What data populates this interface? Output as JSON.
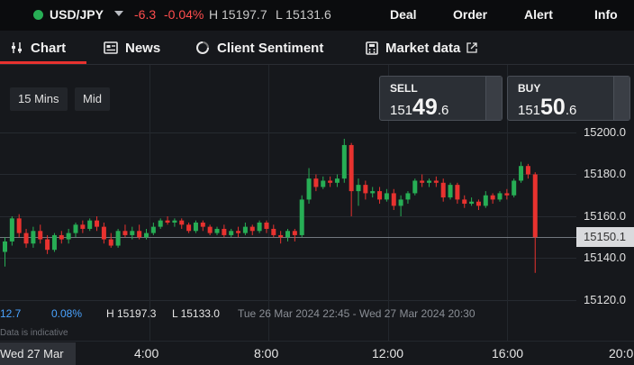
{
  "topbar": {
    "symbol": "USD/JPY",
    "change": "-6.3",
    "change_pct": "-0.04%",
    "high": "H 15197.7",
    "low": "L 15131.6",
    "nav": [
      "Deal",
      "Order",
      "Alert",
      "Info"
    ]
  },
  "tabs": {
    "chart": "Chart",
    "news": "News",
    "sentiment": "Client Sentiment",
    "market": "Market data"
  },
  "timeframe": {
    "interval": "15 Mins",
    "price_type": "Mid"
  },
  "trade": {
    "sell": {
      "label": "SELL",
      "small": "151",
      "big": "49",
      "tail": ".6"
    },
    "buy": {
      "label": "BUY",
      "small": "151",
      "big": "50",
      "tail": ".6"
    }
  },
  "yaxis": {
    "ticks": [
      "15200.0",
      "15180.0",
      "15160.0",
      "15140.0",
      "15120.0"
    ],
    "current": "15150.1"
  },
  "stats": {
    "left_value": "12.7",
    "pct": "0.08%",
    "high": "H 15197.3",
    "low": "L 15133.0",
    "range": "Tue 26 Mar 2024 22:45 - Wed 27 Mar 2024 20:30",
    "indicative": "Data is indicative"
  },
  "xaxis": {
    "current_date": "Wed 27 Mar",
    "ticks": [
      "4:00",
      "8:00",
      "12:00",
      "16:00",
      "20:0"
    ]
  },
  "colors": {
    "up": "#27ae55",
    "down": "#e8322f",
    "accent": "#e8322f"
  },
  "chart_data": {
    "type": "candlestick",
    "yticks": [
      15200,
      15180,
      15160,
      15140,
      15120
    ],
    "current_price": 15150.1,
    "candles": [
      [
        15143,
        15148,
        15136,
        15150
      ],
      [
        15148,
        15159,
        15146,
        15160
      ],
      [
        15159,
        15152,
        15150,
        15161
      ],
      [
        15152,
        15147,
        15145,
        15154
      ],
      [
        15147,
        15153,
        15145,
        15155
      ],
      [
        15153,
        15149,
        15147,
        15156
      ],
      [
        15149,
        15144,
        15142,
        15151
      ],
      [
        15144,
        15151,
        15143,
        15152
      ],
      [
        15151,
        15149,
        15147,
        15153
      ],
      [
        15149,
        15152,
        15147,
        15154
      ],
      [
        15152,
        15156,
        15150,
        15157
      ],
      [
        15156,
        15154,
        15152,
        15158
      ],
      [
        15154,
        15158,
        15153,
        15159
      ],
      [
        15158,
        15155,
        15153,
        15160
      ],
      [
        15155,
        15149,
        15147,
        15157
      ],
      [
        15149,
        15146,
        15145,
        15152
      ],
      [
        15146,
        15153,
        15145,
        15154
      ],
      [
        15153,
        15151,
        15150,
        15156
      ],
      [
        15151,
        15153,
        15149,
        15155
      ],
      [
        15153,
        15150,
        15149,
        15156
      ],
      [
        15150,
        15152,
        15149,
        15154
      ],
      [
        15152,
        15155,
        15151,
        15157
      ],
      [
        15155,
        15158,
        15154,
        15159
      ],
      [
        15158,
        15157,
        15156,
        15160
      ],
      [
        15157,
        15158,
        15155,
        15159
      ],
      [
        15158,
        15156,
        15154,
        15159
      ],
      [
        15156,
        15153,
        15152,
        15157
      ],
      [
        15153,
        15157,
        15152,
        15158
      ],
      [
        15157,
        15155,
        15153,
        15158
      ],
      [
        15155,
        15152,
        15151,
        15156
      ],
      [
        15152,
        15154,
        15151,
        15155
      ],
      [
        15154,
        15151,
        15150,
        15156
      ],
      [
        15151,
        15153,
        15150,
        15154
      ],
      [
        15153,
        15152,
        15150,
        15155
      ],
      [
        15152,
        15155,
        15151,
        15157
      ],
      [
        15155,
        15153,
        15151,
        15156
      ],
      [
        15153,
        15157,
        15152,
        15158
      ],
      [
        15157,
        15154,
        15152,
        15158
      ],
      [
        15154,
        15151,
        15150,
        15156
      ],
      [
        15151,
        15150,
        15147,
        15153
      ],
      [
        15150,
        15153,
        15148,
        15154
      ],
      [
        15153,
        15151,
        15148,
        15154
      ],
      [
        15151,
        15168,
        15150,
        15170
      ],
      [
        15168,
        15178,
        15166,
        15183
      ],
      [
        15178,
        15174,
        15172,
        15180
      ],
      [
        15174,
        15177,
        15173,
        15179
      ],
      [
        15177,
        15176,
        15174,
        15179
      ],
      [
        15176,
        15178,
        15174,
        15180
      ],
      [
        15178,
        15194,
        15176,
        15197
      ],
      [
        15194,
        15172,
        15160,
        15195
      ],
      [
        15172,
        15175,
        15165,
        15178
      ],
      [
        15175,
        15171,
        15168,
        15177
      ],
      [
        15171,
        15172,
        15169,
        15174
      ],
      [
        15172,
        15168,
        15166,
        15174
      ],
      [
        15168,
        15171,
        15167,
        15173
      ],
      [
        15171,
        15165,
        15163,
        15173
      ],
      [
        15165,
        15168,
        15160,
        15170
      ],
      [
        15168,
        15171,
        15166,
        15172
      ],
      [
        15171,
        15177,
        15170,
        15178
      ],
      [
        15177,
        15176,
        15174,
        15180
      ],
      [
        15176,
        15177,
        15174,
        15178
      ],
      [
        15177,
        15176,
        15174,
        15179
      ],
      [
        15176,
        15169,
        15167,
        15178
      ],
      [
        15169,
        15175,
        15168,
        15176
      ],
      [
        15175,
        15168,
        15166,
        15176
      ],
      [
        15168,
        15166,
        15164,
        15170
      ],
      [
        15166,
        15167,
        15165,
        15169
      ],
      [
        15167,
        15165,
        15163,
        15168
      ],
      [
        15165,
        15170,
        15164,
        15172
      ],
      [
        15170,
        15168,
        15166,
        15171
      ],
      [
        15168,
        15171,
        15167,
        15172
      ],
      [
        15171,
        15170,
        15168,
        15173
      ],
      [
        15170,
        15177,
        15169,
        15178
      ],
      [
        15177,
        15184,
        15176,
        15186
      ],
      [
        15184,
        15180,
        15178,
        15185
      ],
      [
        15180,
        15150,
        15133,
        15181
      ]
    ]
  }
}
